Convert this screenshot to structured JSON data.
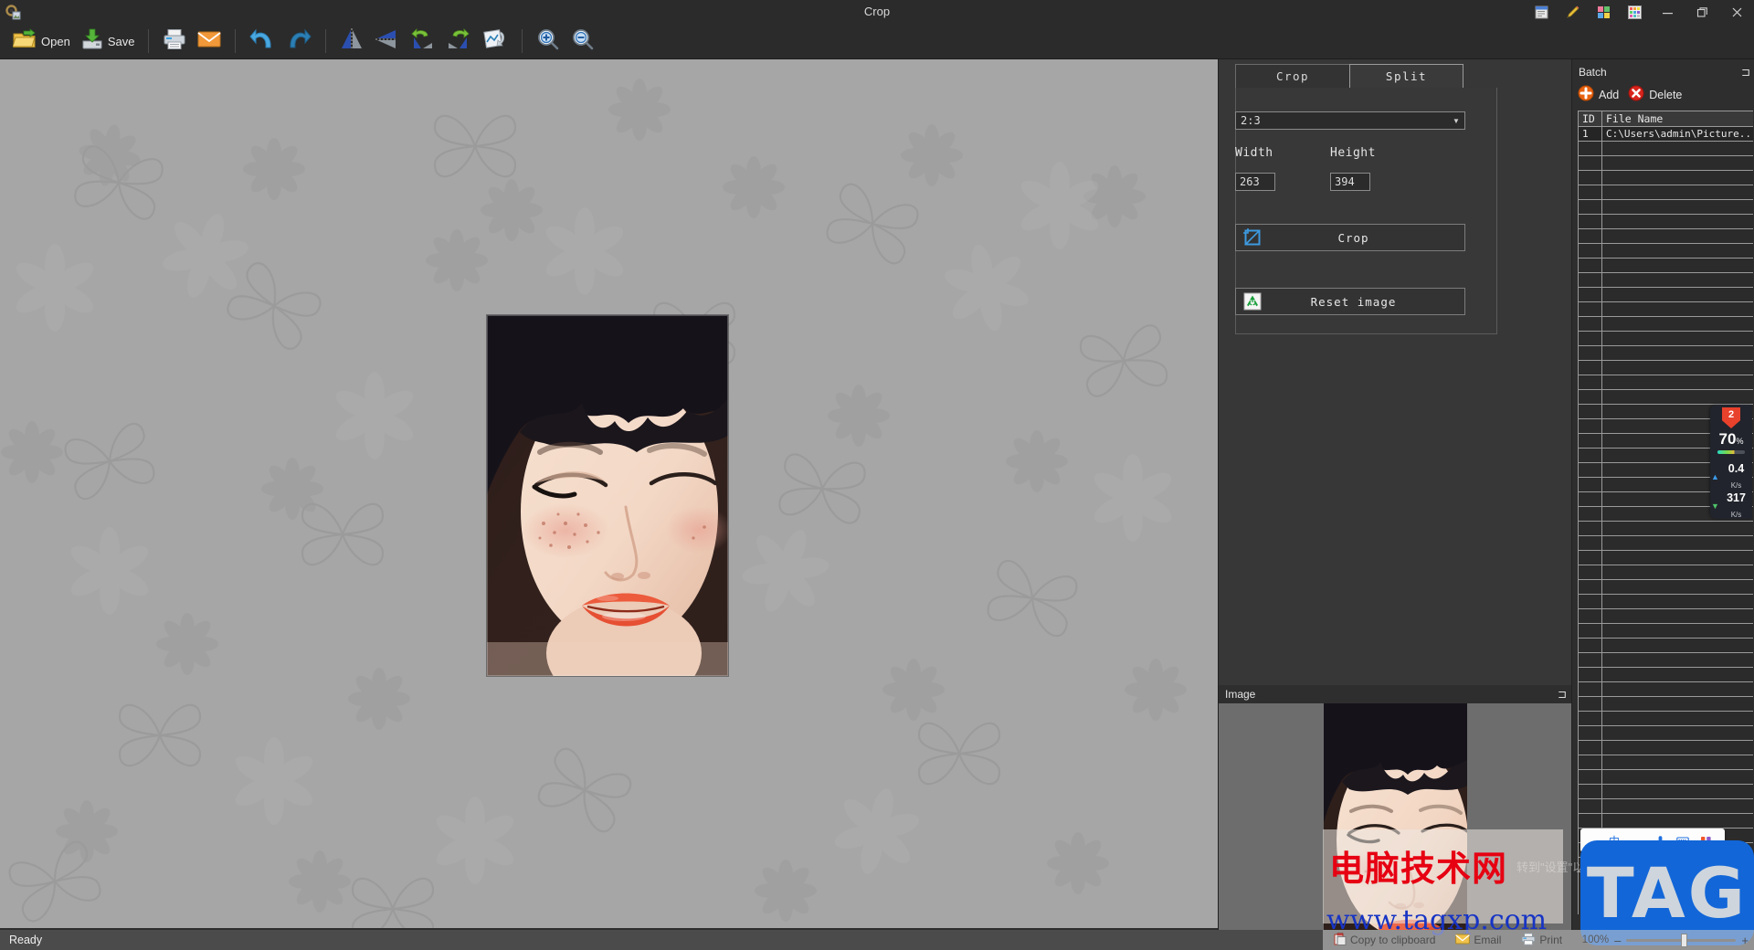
{
  "window": {
    "title": "Crop",
    "app_icon": "gear-image-icon",
    "system_icons": [
      "document-icon",
      "pencil-icon",
      "color-tiles-icon",
      "palette-grid-icon"
    ],
    "controls": {
      "minimize": "–",
      "maximize": "❐",
      "close": "✕"
    }
  },
  "toolbar": {
    "items": [
      {
        "name": "open",
        "label": "Open",
        "icon": "open-folder-icon"
      },
      {
        "name": "save",
        "label": "Save",
        "icon": "save-disk-icon"
      },
      {
        "name": "print",
        "label": "",
        "icon": "printer-icon"
      },
      {
        "name": "email",
        "label": "",
        "icon": "envelope-icon"
      },
      {
        "name": "undo",
        "label": "",
        "icon": "undo-arrow-icon"
      },
      {
        "name": "redo",
        "label": "",
        "icon": "redo-arrow-icon"
      },
      {
        "name": "flip-horizontal",
        "label": "",
        "icon": "flip-horizontal-icon"
      },
      {
        "name": "flip-vertical",
        "label": "",
        "icon": "flip-vertical-icon"
      },
      {
        "name": "rotate-left",
        "label": "",
        "icon": "rotate-left-icon"
      },
      {
        "name": "rotate-right",
        "label": "",
        "icon": "rotate-right-icon"
      },
      {
        "name": "rotate-free",
        "label": "",
        "icon": "rotate-free-icon"
      },
      {
        "name": "zoom-in",
        "label": "",
        "icon": "zoom-in-icon"
      },
      {
        "name": "zoom-out",
        "label": "",
        "icon": "zoom-out-icon"
      }
    ]
  },
  "tool_panel": {
    "tabs": [
      {
        "label": "Crop",
        "active": false
      },
      {
        "label": "Split",
        "active": true
      }
    ],
    "ratio_select": {
      "value": "2:3",
      "options": [
        "2:3"
      ]
    },
    "width": {
      "label": "Width",
      "value": "263"
    },
    "height": {
      "label": "Height",
      "value": "394"
    },
    "crop_button": {
      "label": "Crop",
      "icon": "crop-frame-icon"
    },
    "reset_button": {
      "label": "Reset image",
      "icon": "recycle-icon"
    }
  },
  "image_dock": {
    "title": "Image",
    "pin": "⊐"
  },
  "batch": {
    "title": "Batch",
    "pin": "⊐",
    "add_label": "Add",
    "delete_label": "Delete",
    "columns": [
      "ID",
      "File Name"
    ],
    "rows": [
      {
        "id": "1",
        "file": "C:\\Users\\admin\\Picture..."
      }
    ],
    "empty_row_count": 50
  },
  "statusbar": {
    "text": "Ready"
  },
  "net_widget": {
    "badge": "2",
    "percent": "70",
    "percent_unit": "%",
    "upload": {
      "value": "0.4",
      "unit": "K/s",
      "arrow": "▲"
    },
    "download": {
      "value": "317",
      "unit": "K/s",
      "arrow": "▼"
    }
  },
  "overlay": {
    "watermark_cn": "电脑技术网",
    "watermark_url": "www.tagxp.com",
    "tag_logo": "TAG",
    "windows_activation": "转到\"设置\"以激活 Windows。",
    "ime_items": [
      "中",
      "，",
      "mic-icon",
      "keyboard-icon",
      "apps-icon"
    ],
    "bottom_tools": [
      {
        "label": "Copy to clipboard",
        "icon": "clipboard-icon"
      },
      {
        "label": "Email",
        "icon": "email-icon"
      },
      {
        "label": "Print",
        "icon": "printer-icon"
      }
    ],
    "zoom_level": "100%",
    "zoom_minus": "–",
    "zoom_plus": "+"
  },
  "colors": {
    "window_bg": "#2b2b2b",
    "panel_bg": "#373737",
    "canvas_bg": "#a6a6a6",
    "status_bg": "#4b4b4b",
    "accent_blue": "#1266d8",
    "watermark_red": "#e60012"
  }
}
